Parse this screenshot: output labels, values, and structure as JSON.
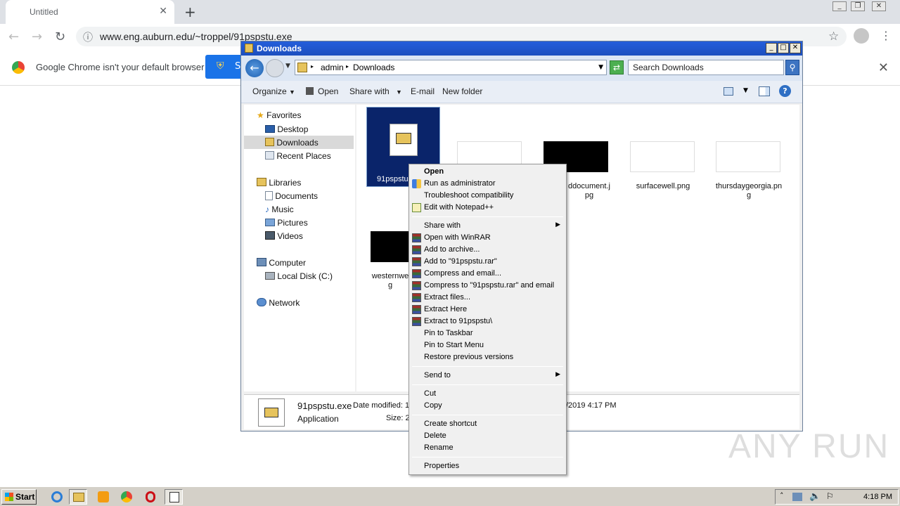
{
  "chrome": {
    "tab_title": "Untitled",
    "url": "www.eng.auburn.edu/~troppel/91pspstu.exe",
    "infobar_text": "Google Chrome isn't your default browser",
    "infobar_button": "S"
  },
  "explorer": {
    "title": "Downloads",
    "breadcrumb": [
      "admin",
      "Downloads"
    ],
    "search_placeholder": "Search Downloads",
    "commands": [
      "Organize",
      "Open",
      "Share with",
      "E-mail",
      "New folder"
    ],
    "nav": {
      "favorites": "Favorites",
      "desktop": "Desktop",
      "downloads": "Downloads",
      "recent": "Recent Places",
      "libraries": "Libraries",
      "documents": "Documents",
      "music": "Music",
      "pictures": "Pictures",
      "videos": "Videos",
      "computer": "Computer",
      "localdisk": "Local Disk (C:)",
      "network": "Network"
    },
    "files": [
      {
        "name": "91pspstu"
      },
      {
        "name": "ddocument.j\npg"
      },
      {
        "name": "surfacewell.png"
      },
      {
        "name": "thursdaygeorgia.pn\ng"
      },
      {
        "name": "westernwe\ng"
      }
    ],
    "details": {
      "filename": "91pspstu.exe",
      "date_label": "Date modified: 1",
      "date_tail": "/2019 4:17 PM",
      "type": "Application",
      "size_label": "Size: 2"
    }
  },
  "context_menu": {
    "open": "Open",
    "run_admin": "Run as administrator",
    "troubleshoot": "Troubleshoot compatibility",
    "notepad": "Edit with Notepad++",
    "share_with": "Share with",
    "open_winrar": "Open with WinRAR",
    "add_archive": "Add to archive...",
    "add_rar": "Add to \"91pspstu.rar\"",
    "compress_email": "Compress and email...",
    "compress_rar_email": "Compress to \"91pspstu.rar\" and email",
    "extract_files": "Extract files...",
    "extract_here": "Extract Here",
    "extract_to": "Extract to 91pspstu\\",
    "pin_taskbar": "Pin to Taskbar",
    "pin_start": "Pin to Start Menu",
    "restore": "Restore previous versions",
    "send_to": "Send to",
    "cut": "Cut",
    "copy": "Copy",
    "create_shortcut": "Create shortcut",
    "delete": "Delete",
    "rename": "Rename",
    "properties": "Properties"
  },
  "taskbar": {
    "start": "Start",
    "clock": "4:18 PM"
  },
  "watermark": "ANY RUN"
}
